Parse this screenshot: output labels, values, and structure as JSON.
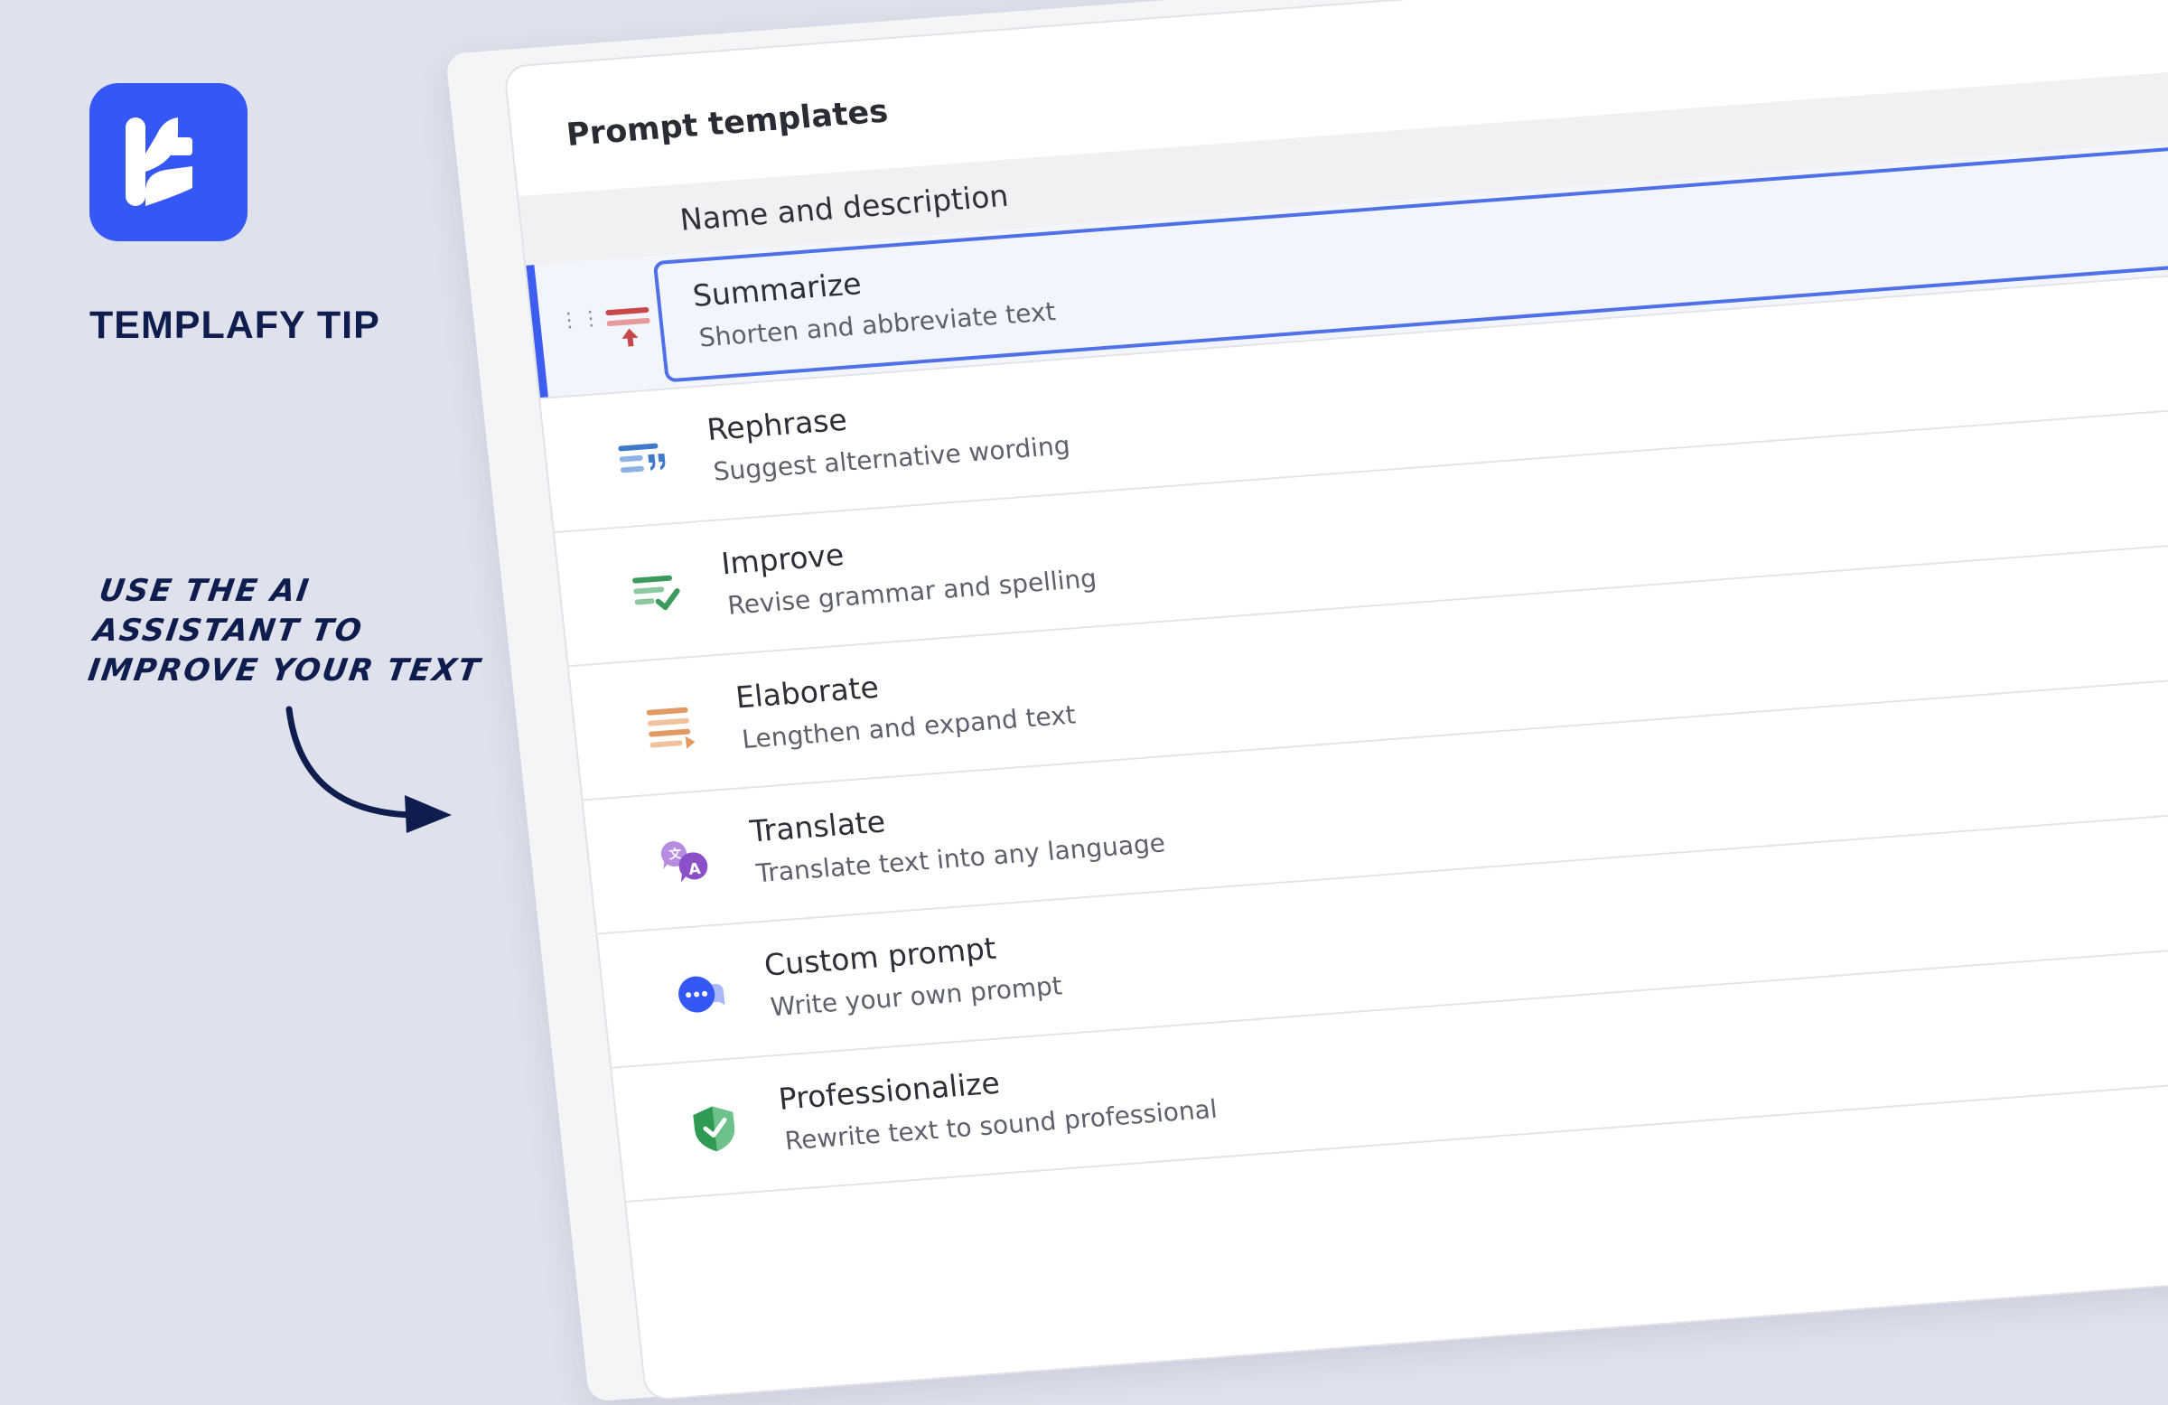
{
  "promo": {
    "title": "TEMPLAFY TIP",
    "note": "USE THE AI ASSISTANT TO IMPROVE YOUR TEXT",
    "brand_color": "#3557f5",
    "text_color": "#0e1d4d"
  },
  "panel": {
    "title": "Prompt templates",
    "column_header": "Name and description",
    "selected_index": 0,
    "accent_color": "#3d5cf0"
  },
  "templates": [
    {
      "name": "Summarize",
      "description": "Shorten and abbreviate text",
      "icon": "summarize-icon",
      "color": "#c8484a"
    },
    {
      "name": "Rephrase",
      "description": "Suggest alternative wording",
      "icon": "rephrase-icon",
      "color": "#3f79c9"
    },
    {
      "name": "Improve",
      "description": "Revise grammar and spelling",
      "icon": "improve-icon",
      "color": "#3a9a5c"
    },
    {
      "name": "Elaborate",
      "description": "Lengthen and expand text",
      "icon": "elaborate-icon",
      "color": "#e39a62"
    },
    {
      "name": "Translate",
      "description": "Translate text into any language",
      "icon": "translate-icon",
      "color": "#8b4fc8"
    },
    {
      "name": "Custom prompt",
      "description": "Write your own prompt",
      "icon": "chat-bubble-icon",
      "color": "#3557f5"
    },
    {
      "name": "Professionalize",
      "description": "Rewrite text to sound professional",
      "icon": "shield-icon",
      "color": "#2f9a52"
    }
  ]
}
